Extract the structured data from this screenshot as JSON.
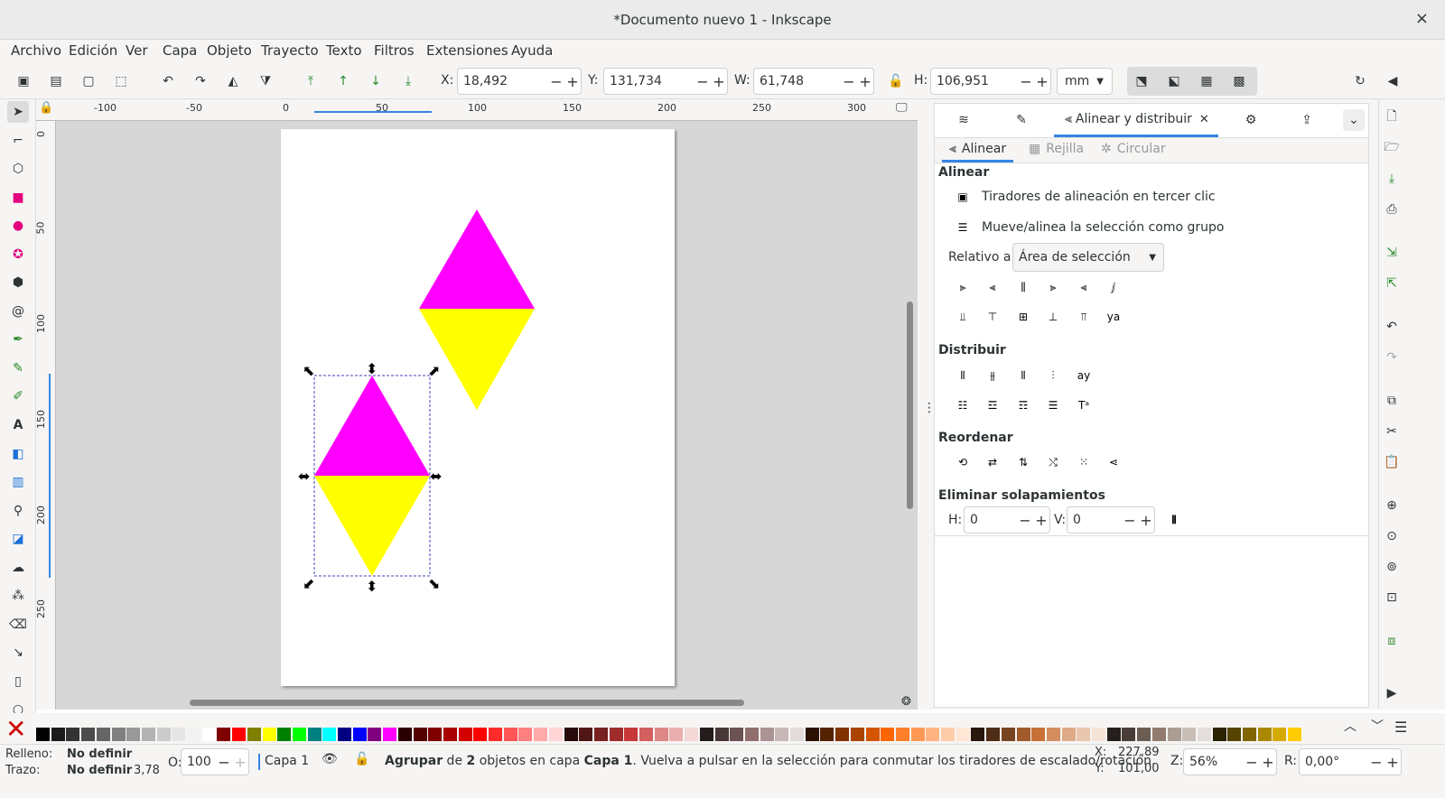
{
  "window": {
    "title": "*Documento nuevo 1 - Inkscape",
    "close": "×"
  },
  "menu": [
    "Archivo",
    "Edición",
    "Ver",
    "Capa",
    "Objeto",
    "Trayecto",
    "Texto",
    "Filtros",
    "Extensiones",
    "Ayuda"
  ],
  "toolbar": {
    "x_label": "X:",
    "x_value": "18,492",
    "y_label": "Y:",
    "y_value": "131,734",
    "w_label": "W:",
    "w_value": "61,748",
    "h_label": "H:",
    "h_value": "106,951",
    "unit": "mm",
    "minus": "−",
    "plus": "+"
  },
  "ruler_h": [
    "-100",
    "-50",
    "0",
    "50",
    "100",
    "150",
    "200",
    "250",
    "300"
  ],
  "ruler_v": [
    "0",
    "50",
    "100",
    "150",
    "200",
    "250"
  ],
  "dock_tabs": {
    "active": "Alinear y distribuir"
  },
  "panel": {
    "subtabs": [
      "Alinear",
      "Rejilla",
      "Circular"
    ],
    "align_heading": "Alinear",
    "option1": "Tiradores de alineación en tercer clic",
    "option2": "Mueve/alinea la selección como grupo",
    "relative_label": "Relativo a:",
    "relative_value": "Área de selección",
    "distribute_heading": "Distribuir",
    "reorder_heading": "Reordenar",
    "overlap_heading": "Eliminar solapamientos",
    "h_label": "H:",
    "h_value": "0",
    "v_label": "V:",
    "v_value": "0"
  },
  "status": {
    "fill_label": "Relleno:",
    "fill_value": "No definir",
    "stroke_label": "Trazo:",
    "stroke_value": "No definir",
    "stroke_width": "3,78",
    "opacity_label": "O:",
    "opacity_value": "100",
    "layer": "Capa 1",
    "msg_1": "Agrupar",
    "msg_2": " de ",
    "msg_3": "2",
    "msg_4": " objetos en capa ",
    "msg_5": "Capa 1",
    "msg_6": ". Vuelva a pulsar en la selección para conmutar los tiradores de escalado/rotación.",
    "cx_label": "X:",
    "cx_value": "227,89",
    "cy_label": "Y:",
    "cy_value": "101,00",
    "zoom_label": "Z:",
    "zoom_value": "56%",
    "rot_label": "R:",
    "rot_value": "0,00°"
  },
  "colors": {
    "magenta": "#ff00ff",
    "yellow": "#ffff00",
    "accent": "#3584e4"
  }
}
